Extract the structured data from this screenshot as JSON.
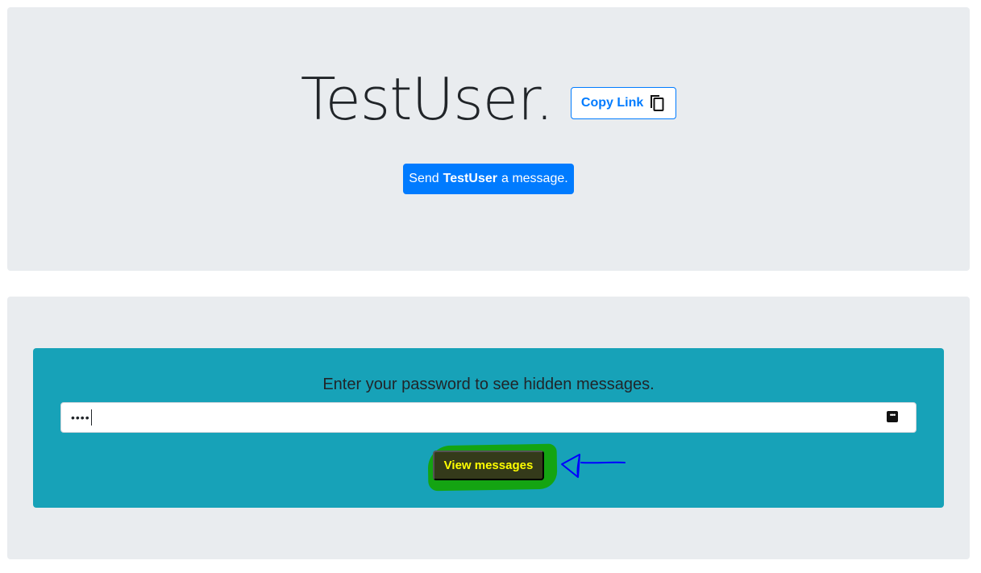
{
  "header": {
    "username": "TestUser.",
    "copy_link_label": "Copy Link",
    "send_prefix": "Send",
    "send_name": "TestUser",
    "send_suffix": "a message."
  },
  "password_panel": {
    "prompt": "Enter your password to see hidden messages.",
    "password_value": "••••",
    "view_button_label": "View messages"
  },
  "colors": {
    "jumbotron_bg": "#e9ecef",
    "primary": "#007bff",
    "info_panel": "#17a2b8",
    "annotation_highlight": "#14a412",
    "annotation_arrow": "#0000ff",
    "view_button_text": "#ffff00"
  },
  "icons": {
    "copy": "copy-icon",
    "reveal": "password-reveal-icon",
    "annotation": "hand-drawn-arrow-icon"
  }
}
